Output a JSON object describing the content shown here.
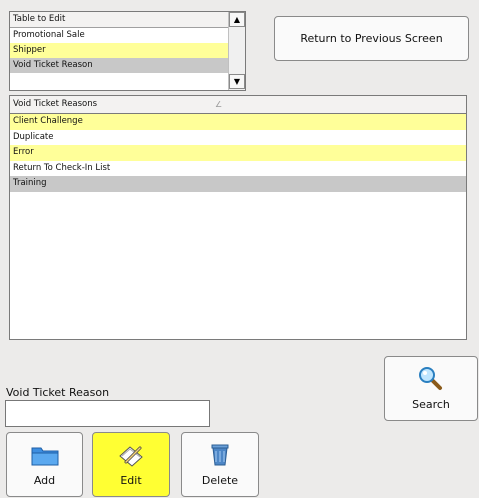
{
  "table_to_edit": {
    "header": "Table to Edit",
    "rows": [
      "Promotional Sale",
      "Shipper",
      "Void Ticket Reason"
    ],
    "scroll_up": "▲",
    "scroll_down": "▼"
  },
  "return_button": {
    "label": "Return to Previous Screen"
  },
  "reasons_table": {
    "header": "Void Ticket Reasons",
    "sort_glyph": "∠",
    "rows": [
      "Client Challenge",
      "Duplicate",
      "Error",
      "Return To Check-In List",
      "Training"
    ]
  },
  "field": {
    "label": "Void Ticket Reason",
    "value": ""
  },
  "buttons": {
    "search": {
      "label": "Search",
      "icon": "magnifier-icon"
    },
    "add": {
      "label": "Add",
      "icon": "folder-icon"
    },
    "edit": {
      "label": "Edit",
      "icon": "edit-pencil-icon"
    },
    "delete": {
      "label": "Delete",
      "icon": "recycle-bin-icon"
    }
  },
  "colors": {
    "highlight": "#ffff99",
    "selected": "#c8c8c8",
    "active_button": "#ffff33"
  }
}
